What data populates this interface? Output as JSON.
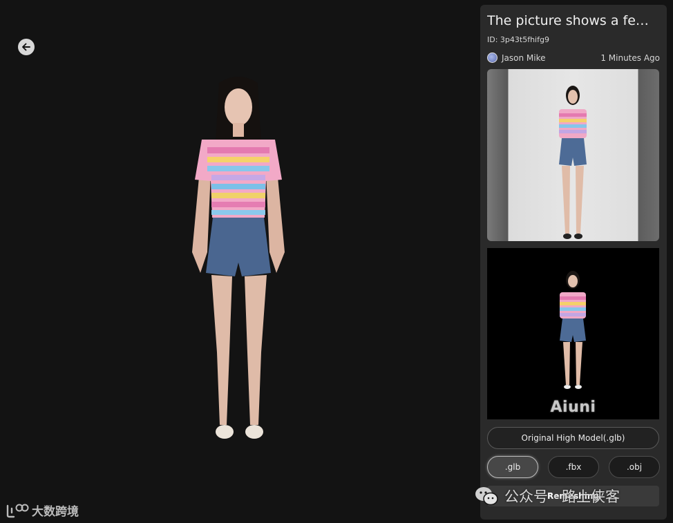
{
  "viewer": {
    "back_icon": "arrow-left-icon"
  },
  "panel": {
    "title": "The picture shows a femal...",
    "id_text": "ID: 3p43t5fhifg9",
    "author_name": "Jason Mike",
    "time_ago": "1 Minutes Ago",
    "render_watermark": "Aiuni",
    "download_label": "Original High Model(.glb)",
    "formats": [
      ".glb",
      ".fbx",
      ".obj"
    ],
    "selected_format": ".glb",
    "remesh_label": "Remeshing"
  },
  "watermarks": {
    "logo_text": "大数跨境",
    "wechat_text": "公众号 · 路上侠客"
  },
  "colors": {
    "background": "#131313",
    "panel": "#2a2a2a"
  }
}
